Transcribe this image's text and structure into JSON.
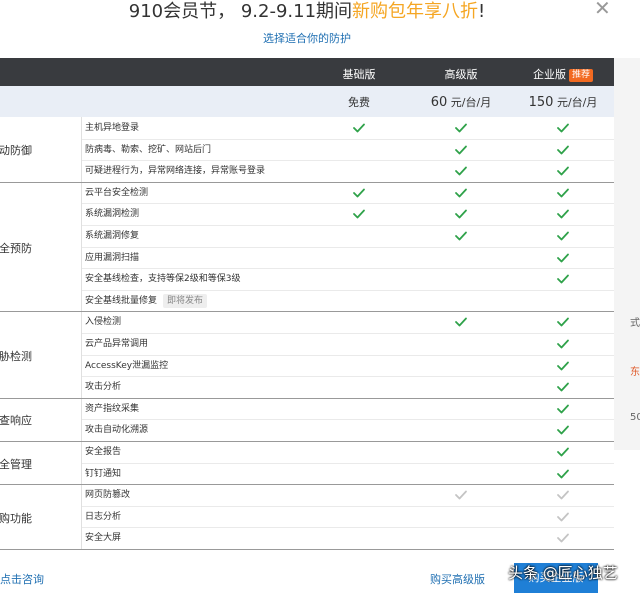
{
  "title": {
    "prefix": "910会员节， 9.2-9.11期间",
    "promo": "新购包年享八折",
    "suffix": "!"
  },
  "subtitle": "选择适合你的防护",
  "close_icon": "close-icon",
  "plans": [
    {
      "name": "基础版",
      "price": "免费",
      "price_num": "",
      "price_unit": ""
    },
    {
      "name": "高级版",
      "price": "",
      "price_num": "60",
      "price_unit": " 元/台/月"
    },
    {
      "name": "企业版",
      "price": "",
      "price_num": "150",
      "price_unit": " 元/台/月",
      "badge": "推荐"
    }
  ],
  "groups": [
    {
      "name": "主动防御",
      "features": [
        {
          "label": "主机异地登录",
          "checks": [
            "green",
            "green",
            "green"
          ]
        },
        {
          "label": "防病毒、勒索、挖矿、网站后门",
          "checks": [
            "",
            "green",
            "green"
          ]
        },
        {
          "label": "可疑进程行为，异常网络连接，异常账号登录",
          "checks": [
            "",
            "green",
            "green"
          ]
        }
      ]
    },
    {
      "name": "安全预防",
      "features": [
        {
          "label": "云平台安全检测",
          "checks": [
            "green",
            "green",
            "green"
          ]
        },
        {
          "label": "系统漏洞检测",
          "checks": [
            "green",
            "green",
            "green"
          ]
        },
        {
          "label": "系统漏洞修复",
          "checks": [
            "",
            "green",
            "green"
          ]
        },
        {
          "label": "应用漏洞扫描",
          "checks": [
            "",
            "",
            "green"
          ]
        },
        {
          "label": "安全基线检查，支持等保2级和等保3级",
          "checks": [
            "",
            "",
            "green"
          ]
        },
        {
          "label": "安全基线批量修复",
          "soon": "即将发布",
          "checks": [
            "",
            "",
            ""
          ]
        }
      ]
    },
    {
      "name": "威胁检测",
      "features": [
        {
          "label": "入侵检测",
          "checks": [
            "",
            "green",
            "green"
          ]
        },
        {
          "label": "云产品异常调用",
          "checks": [
            "",
            "",
            "green"
          ]
        },
        {
          "label": "AccessKey泄漏监控",
          "checks": [
            "",
            "",
            "green"
          ]
        },
        {
          "label": "攻击分析",
          "checks": [
            "",
            "",
            "green"
          ]
        }
      ]
    },
    {
      "name": "调查响应",
      "features": [
        {
          "label": "资产指纹采集",
          "checks": [
            "",
            "",
            "green"
          ]
        },
        {
          "label": "攻击自动化溯源",
          "checks": [
            "",
            "",
            "green"
          ]
        }
      ]
    },
    {
      "name": "安全管理",
      "features": [
        {
          "label": "安全报告",
          "checks": [
            "",
            "",
            "green"
          ]
        },
        {
          "label": "钉钉通知",
          "checks": [
            "",
            "",
            "green"
          ]
        }
      ]
    },
    {
      "name": "选购功能",
      "features": [
        {
          "label": "网页防篡改",
          "checks": [
            "",
            "gray",
            "gray"
          ]
        },
        {
          "label": "日志分析",
          "checks": [
            "",
            "",
            "gray"
          ]
        },
        {
          "label": "安全大屏",
          "checks": [
            "",
            "",
            "gray"
          ]
        }
      ]
    }
  ],
  "footer": {
    "consult": "点击咨询",
    "buy_advanced": "购买高级版",
    "buy_enterprise": "购买企业版"
  },
  "watermark": "头条 @匠心独艺",
  "right_strip": [
    "式",
    "东",
    "50"
  ],
  "colors": {
    "header_bg": "#393b3f",
    "price_bg": "#e9eef6",
    "check_green": "#2fa24a",
    "check_gray": "#c4c4c4",
    "promo": "#f5a623",
    "link": "#1f6fb2",
    "badge": "#f26a21",
    "button": "#1f7fd6"
  }
}
